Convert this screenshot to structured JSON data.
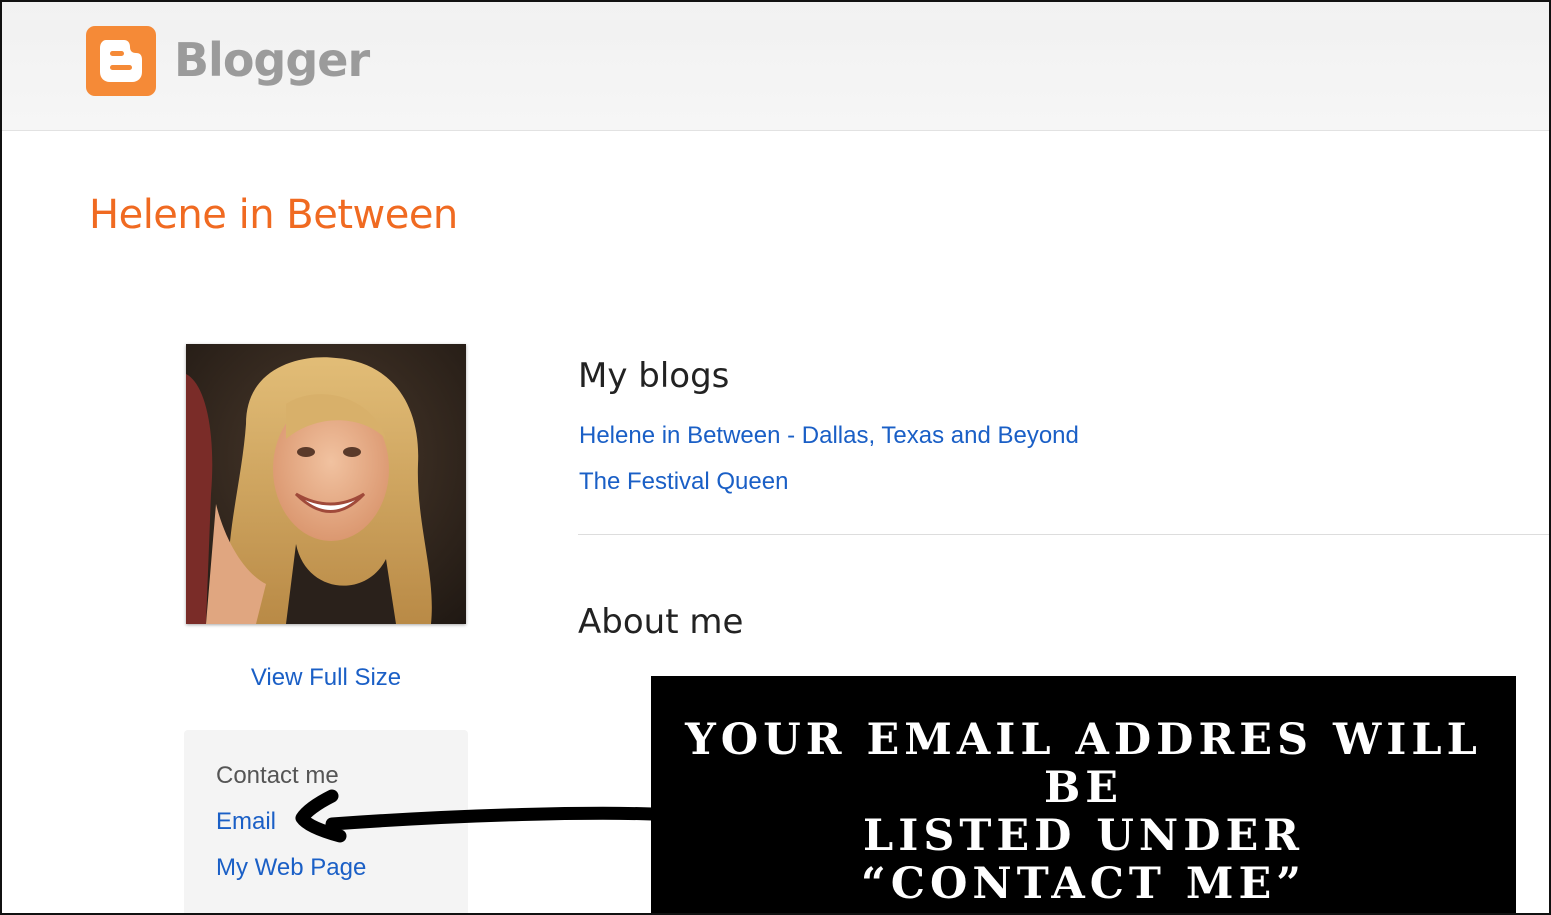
{
  "header": {
    "brand": "Blogger",
    "logo_color": "#f58a37"
  },
  "profile": {
    "name": "Helene in Between",
    "view_full_size": "View Full Size"
  },
  "contact": {
    "title": "Contact me",
    "email_label": "Email",
    "web_page_label": "My Web Page"
  },
  "blogs": {
    "title": "My blogs",
    "items": [
      {
        "label": "Helene in Between - Dallas, Texas and Beyond"
      },
      {
        "label": "The Festival Queen"
      }
    ]
  },
  "about": {
    "title": "About me"
  },
  "annotation": {
    "line1": "Your email addres will be",
    "line2": "listed under",
    "line3": "“contact me”"
  },
  "colors": {
    "accent_orange": "#f06a21",
    "link_blue": "#1a5fc6"
  }
}
